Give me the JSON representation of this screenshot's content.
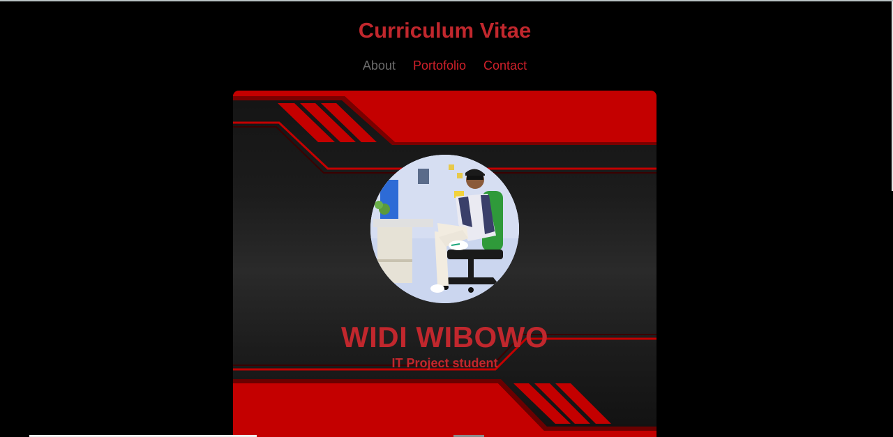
{
  "header": {
    "title": "Curriculum Vitae"
  },
  "nav": {
    "items": [
      {
        "label": "About"
      },
      {
        "label": "Portofolio"
      },
      {
        "label": "Contact"
      }
    ]
  },
  "profile": {
    "name": "WIDI WIBOWO",
    "role": "IT Project student"
  },
  "colors": {
    "accent": "#c1272d",
    "nav_active": "#6b6b6b",
    "background": "#000000",
    "card_red": "#c00000"
  }
}
